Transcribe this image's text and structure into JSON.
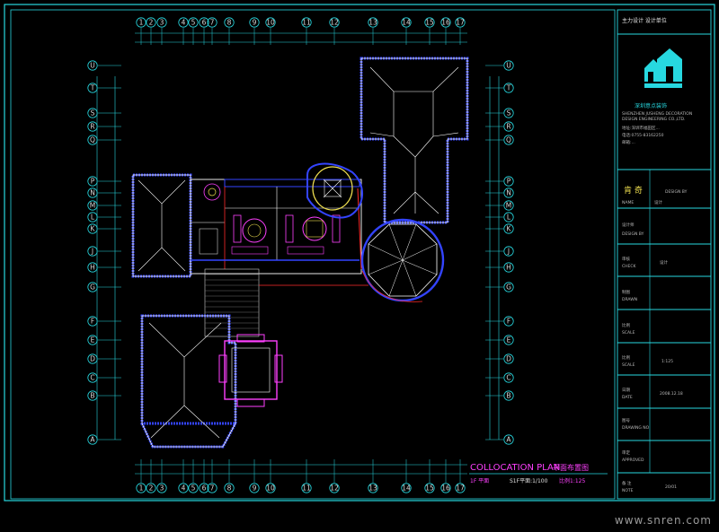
{
  "drawing": {
    "plan_title_en": "COLLOCATION PLAN",
    "plan_title_cn": "平面布置图",
    "scale_left": "1F 平面",
    "scale_mid": "S1F平面:1/100",
    "scale_right": "比例1:125",
    "grid_columns": [
      "1",
      "2",
      "3",
      "4",
      "5",
      "6",
      "7",
      "8",
      "9",
      "10",
      "11",
      "12",
      "13",
      "14",
      "15",
      "16",
      "17"
    ],
    "grid_rows": [
      "U",
      "T",
      "S",
      "R",
      "Q",
      "P",
      "N",
      "M",
      "L",
      "K",
      "J",
      "H",
      "G",
      "F",
      "E",
      "D",
      "C",
      "B",
      "A"
    ]
  },
  "title_block": {
    "top_cn": "主力设计 设计单位",
    "logo_cn": "深圳意点装饰",
    "company_cn": "深圳意点装饰",
    "company_en_1": "SHENZHEN JUSHENG DECORATION",
    "company_en_2": "DESIGN ENGINEERING CO.,LTD.",
    "address": "地址:深圳市福田区...",
    "tel": "电话:0755-83162250",
    "email": "邮箱:...",
    "project_cn": "肯 奇",
    "project_en": "DESIGN BY",
    "row_name_label": "NAME",
    "row_name_val": "设计",
    "row_designer": "DESIGN BY",
    "row_design_label": "设计师",
    "row_check_cn": "审核",
    "row_check_en": "CHECK",
    "row_val_a": "设计",
    "row_drawn_cn": "制图",
    "row_drawn_en": "DRAWN",
    "row_scale_cn": "比例",
    "row_scale_en": "SCALE",
    "row_scale_val": "1:125",
    "row_date_cn": "日期",
    "row_date_en": "DATE",
    "row_date_val": "2008.12.18",
    "row_no_cn": "图号",
    "row_no_en": "DRAWING NO",
    "row_approve_cn": "审定",
    "row_approve_en": "APPROVED",
    "row_sheet_cn": "备 注",
    "row_sheet_en": "NOTE",
    "row_sheet_val": "20/01"
  },
  "watermark": "www.snren.com",
  "colors": {
    "frame": "#27d8e0",
    "wall": "#ffffff",
    "furniture": "#ff40ff",
    "hatch": "#3344ff",
    "accent_red": "#ff2a2a",
    "accent_yellow": "#f0e050",
    "text": "#e0e0e0"
  }
}
